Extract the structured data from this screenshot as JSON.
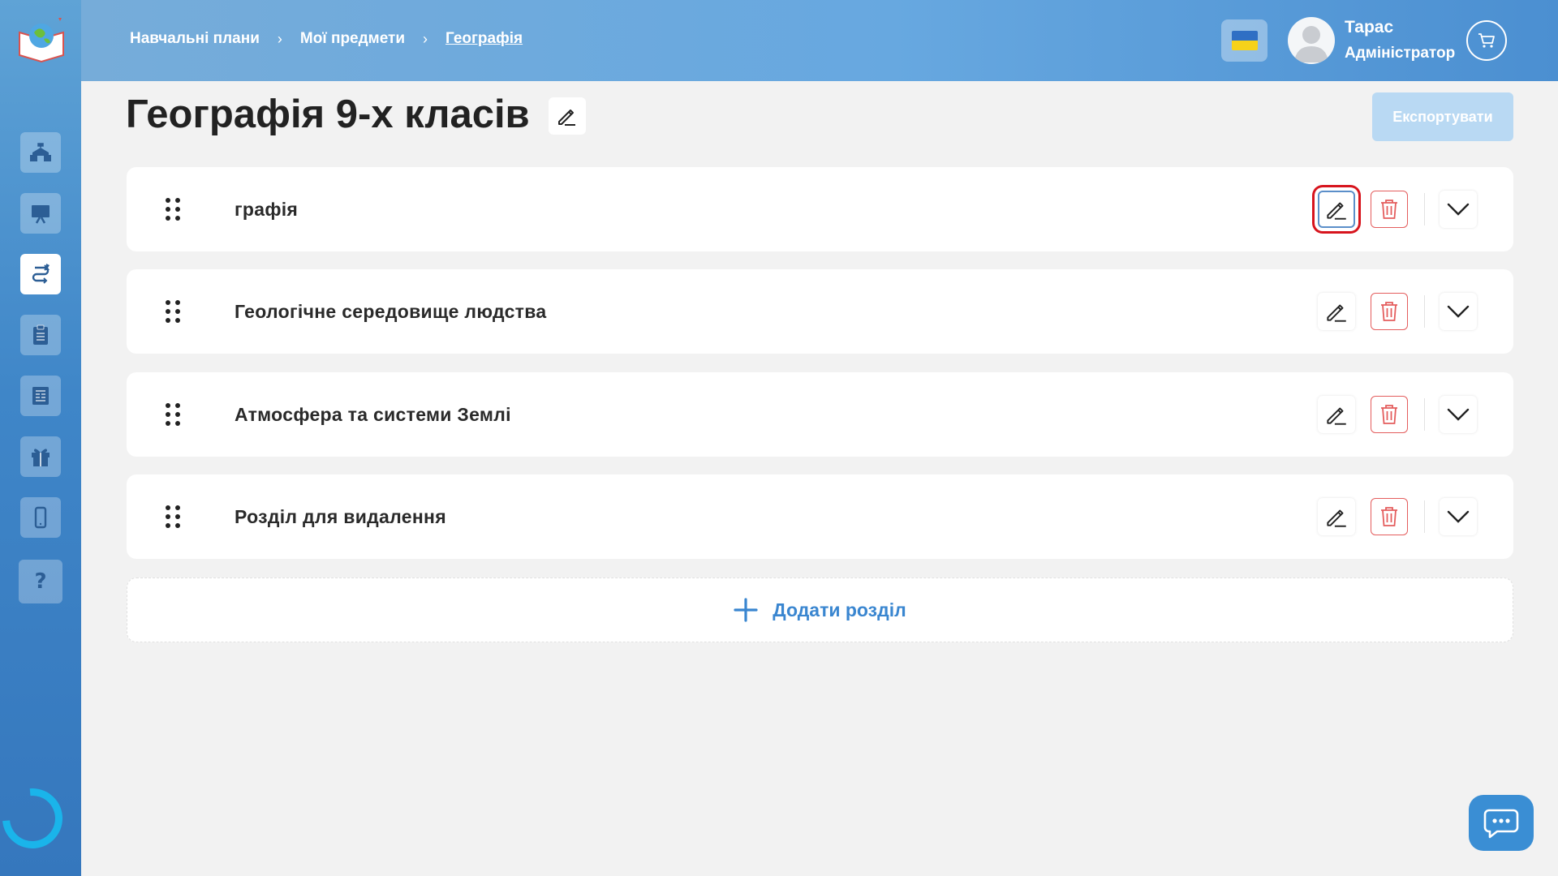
{
  "breadcrumb": {
    "items": [
      "Навчальні плани",
      "Мої предмети",
      "Географія"
    ],
    "separator": "›"
  },
  "user": {
    "name": "Тарас",
    "role": "Адміністратор"
  },
  "language_flag": "ukraine-flag",
  "page": {
    "title": "Географія 9-х класів",
    "export_label": "Експортувати"
  },
  "sections": [
    {
      "title": "графія"
    },
    {
      "title": "Геологічне середовище людства"
    },
    {
      "title": "Атмосфера та системи Землі"
    },
    {
      "title": "Розділ для видалення"
    }
  ],
  "add_section_label": "Додати розділ",
  "sidebar": {
    "items": [
      {
        "icon": "school-icon"
      },
      {
        "icon": "presentation-board-icon"
      },
      {
        "icon": "route-icon"
      },
      {
        "icon": "clipboard-icon"
      },
      {
        "icon": "newspaper-icon"
      },
      {
        "icon": "gift-icon"
      },
      {
        "icon": "smartphone-icon"
      },
      {
        "icon": "help-icon",
        "label": "?"
      }
    ]
  },
  "colors": {
    "accent": "#3a86d0",
    "delete": "#e45d5d",
    "highlight": "#d7141d",
    "export_disabled": "#b9d9f3"
  }
}
